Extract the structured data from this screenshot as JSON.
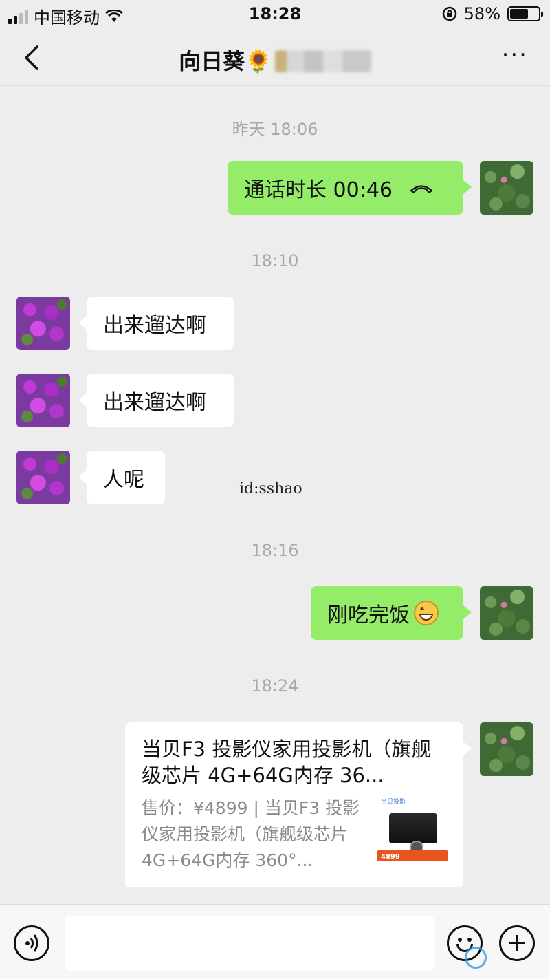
{
  "status_bar": {
    "carrier": "中国移动",
    "time": "18:28",
    "battery_percent": "58%",
    "battery_level": 0.58
  },
  "nav": {
    "title": "向日葵🌻",
    "back_icon": "chevron-left-icon",
    "more_icon": "more-dots-icon",
    "more_label": "···"
  },
  "messages": {
    "time_1": "昨天 18:06",
    "call_text": "通话时长 00:46",
    "time_2": "18:10",
    "msg_1": "出来遛达啊",
    "msg_2": "出来遛达啊",
    "msg_3": "人呢",
    "time_3": "18:16",
    "msg_4": "刚吃完饭",
    "time_4": "18:24"
  },
  "watermark": "id:sshao",
  "link_card": {
    "title": "当贝F3 投影仪家用投影机（旗舰级芯片 4G+64G内存 36...",
    "description": "售价：¥4899 | 当贝F3 投影仪家用投影机（旗舰级芯片 4G+64G内存 360°...",
    "thumb_brand": "当贝投影",
    "thumb_price": "4899"
  },
  "input_bar": {
    "placeholder": "",
    "voice_icon": "voice-icon",
    "emoji_icon": "emoji-icon",
    "plus_icon": "plus-icon"
  },
  "colors": {
    "background": "#ededed",
    "my_bubble": "#95ec69",
    "their_bubble": "#ffffff",
    "timestamp": "#a8a8a8"
  }
}
